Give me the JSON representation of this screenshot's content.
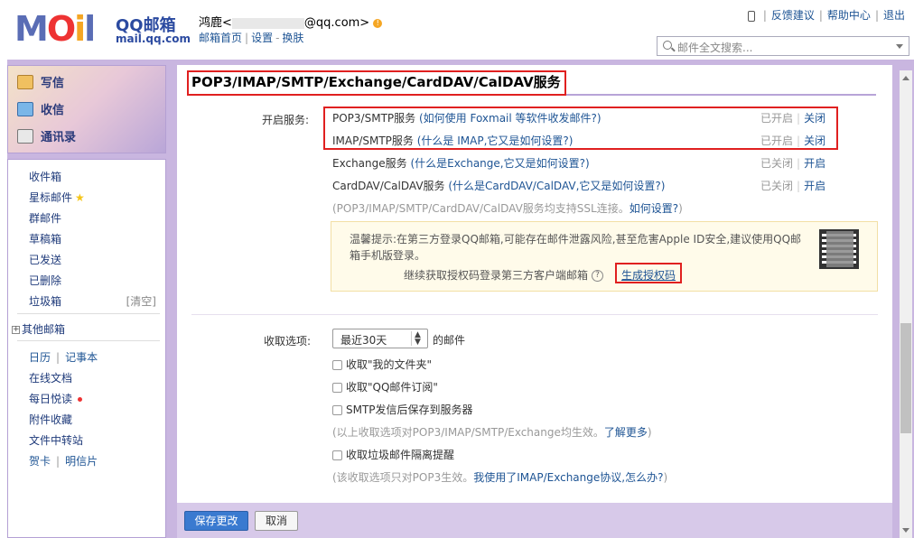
{
  "header": {
    "logo_text": "MOil",
    "logo_cn": "QQ邮箱",
    "logo_url": "mail.qq.com",
    "user_name": "鸿鹿<",
    "user_email_suffix": "@qq.com>",
    "links": [
      "邮箱首页",
      "设置",
      "换肤"
    ],
    "top_links": [
      "反馈建议",
      "帮助中心",
      "退出"
    ],
    "search_placeholder": "邮件全文搜索..."
  },
  "sidebar": {
    "quick": [
      "写信",
      "收信",
      "通讯录"
    ],
    "folders": [
      "收件箱",
      "星标邮件",
      "群邮件",
      "草稿箱",
      "已发送",
      "已删除",
      "垃圾箱"
    ],
    "clear": "[清空]",
    "other_mail": "其他邮箱",
    "tools": {
      "calendar": "日历",
      "notes": "记事本",
      "docs": "在线文档",
      "daily": "每日悦读",
      "attach": "附件收藏",
      "transfer": "文件中转站",
      "card": "贺卡",
      "postcard": "明信片"
    }
  },
  "main": {
    "section_title": "POP3/IMAP/SMTP/Exchange/CardDAV/CalDAV服务",
    "enable_label": "开启服务:",
    "services": [
      {
        "name": "POP3/SMTP服务",
        "hint": "(如何使用 Foxmail 等软件收发邮件?)",
        "status": "已开启",
        "action": "关闭"
      },
      {
        "name": "IMAP/SMTP服务",
        "hint": "(什么是 IMAP,它又是如何设置?)",
        "status": "已开启",
        "action": "关闭"
      },
      {
        "name": "Exchange服务",
        "hint": "(什么是Exchange,它又是如何设置?)",
        "status": "已关闭",
        "action": "开启"
      },
      {
        "name": "CardDAV/CalDAV服务",
        "hint": "(什么是CardDAV/CalDAV,它又是如何设置?)",
        "status": "已关闭",
        "action": "开启"
      }
    ],
    "ssl_note_prefix": "(POP3/IMAP/SMTP/CardDAV/CalDAV服务均支持SSL连接。",
    "ssl_note_link": "如何设置?",
    "ssl_note_suffix": ")",
    "tip_text": "温馨提示:在第三方登录QQ邮箱,可能存在邮件泄露风险,甚至危害Apple ID安全,建议使用QQ邮箱手机版登录。",
    "tip_line2": "继续获取授权码登录第三方客户端邮箱",
    "tip_q": "?",
    "gen_code": "生成授权码",
    "fetch_label": "收取选项:",
    "fetch_select": "最近30天",
    "fetch_suffix": "的邮件",
    "options": [
      "收取\"我的文件夹\"",
      "收取\"QQ邮件订阅\"",
      "SMTP发信后保存到服务器"
    ],
    "options_note_prefix": "(以上收取选项对POP3/IMAP/SMTP/Exchange均生效。",
    "options_note_link": "了解更多",
    "options_note_suffix": ")",
    "spam_option": "收取垃圾邮件隔离提醒",
    "pop3_note_prefix": "(该收取选项只对POP3生效。",
    "pop3_note_link": "我使用了IMAP/Exchange协议,怎么办?",
    "pop3_note_suffix": ")"
  },
  "footer": {
    "save": "保存更改",
    "cancel": "取消"
  },
  "colors": {
    "accent": "#3a7ad0",
    "frame": "#c9b6e0",
    "highlight": "#e02020",
    "link": "#1e5494"
  }
}
